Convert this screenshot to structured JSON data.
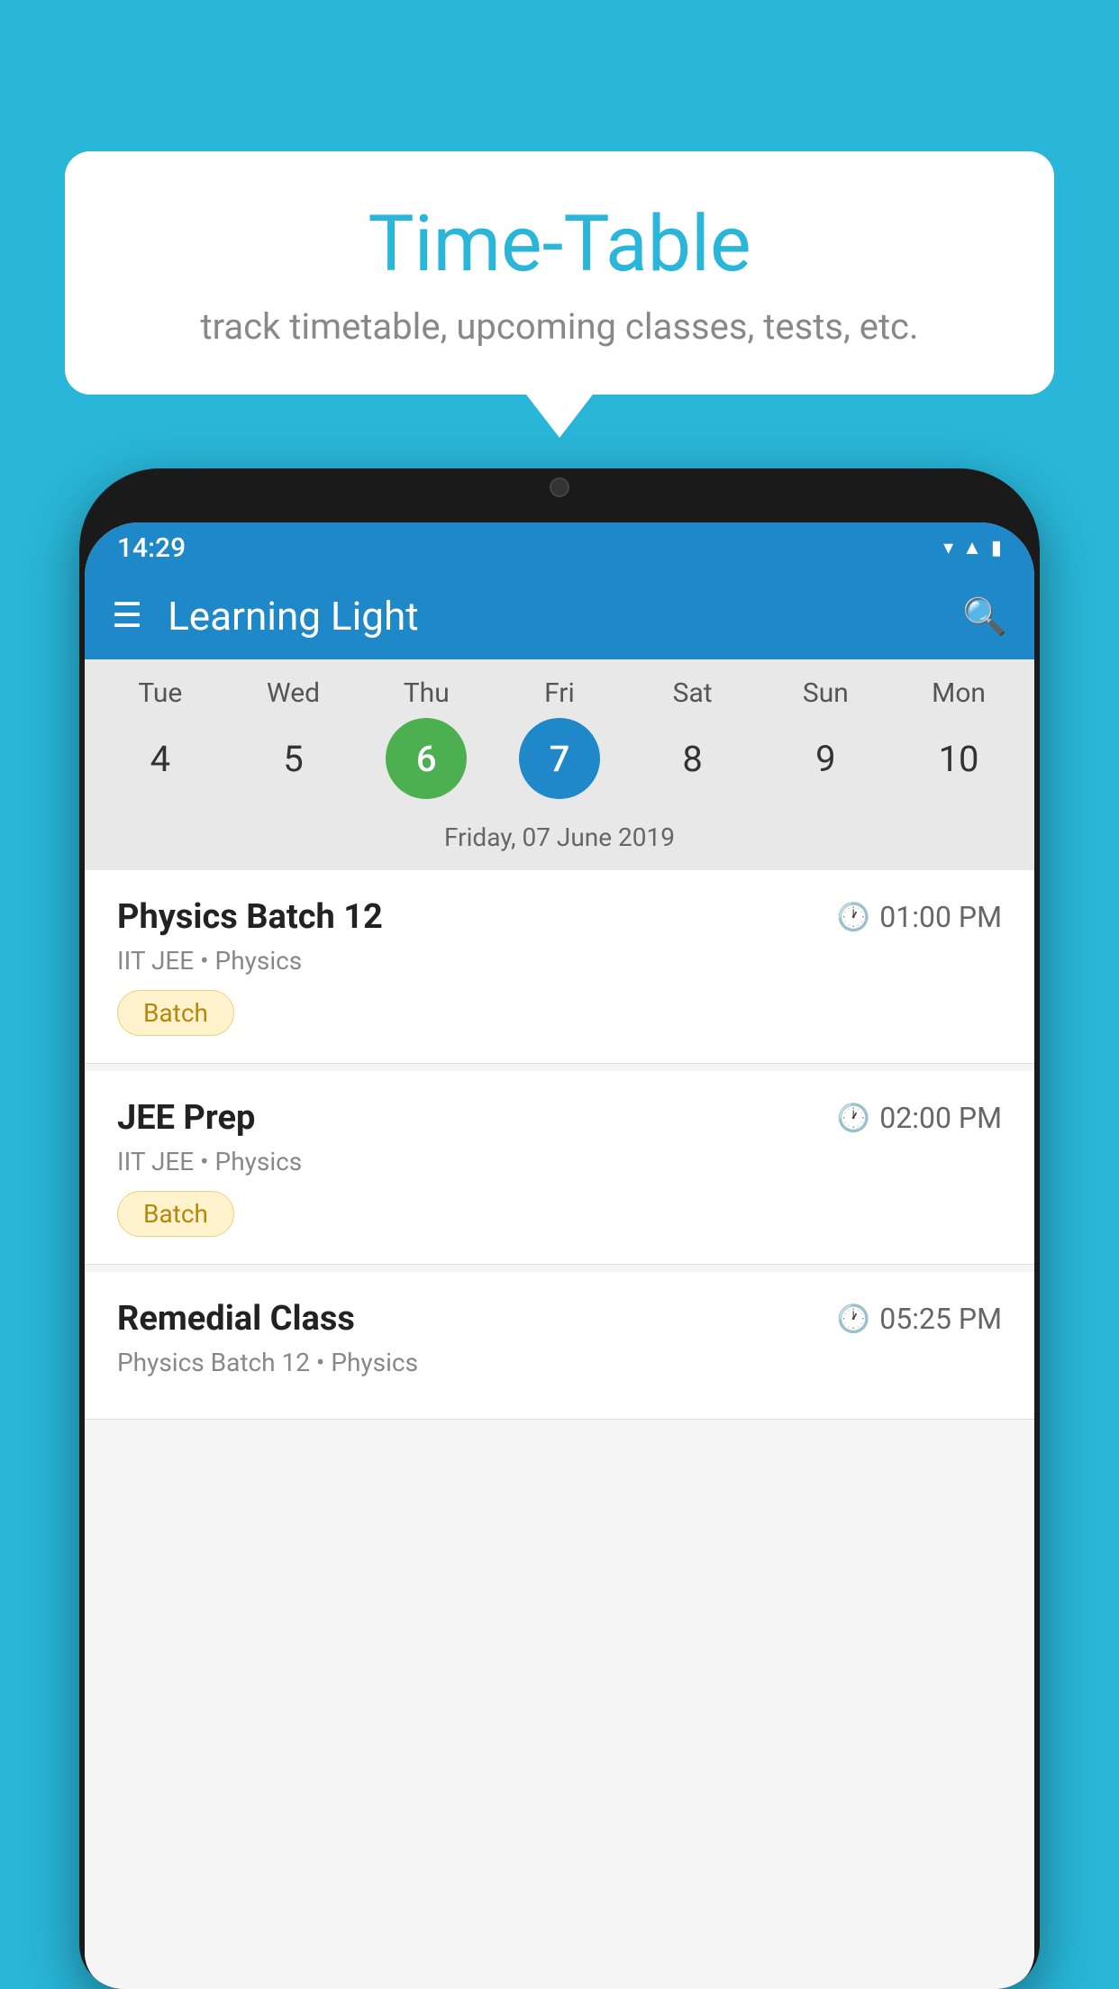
{
  "background": {
    "color": "#29b6d8"
  },
  "bubble": {
    "title": "Time-Table",
    "subtitle": "track timetable, upcoming classes, tests, etc."
  },
  "phone": {
    "status_bar": {
      "time": "14:29"
    },
    "app_bar": {
      "title": "Learning Light"
    },
    "calendar": {
      "days": [
        {
          "name": "Tue",
          "num": "4",
          "state": "normal"
        },
        {
          "name": "Wed",
          "num": "5",
          "state": "normal"
        },
        {
          "name": "Thu",
          "num": "6",
          "state": "today"
        },
        {
          "name": "Fri",
          "num": "7",
          "state": "selected"
        },
        {
          "name": "Sat",
          "num": "8",
          "state": "normal"
        },
        {
          "name": "Sun",
          "num": "9",
          "state": "normal"
        },
        {
          "name": "Mon",
          "num": "10",
          "state": "normal"
        }
      ],
      "current_date": "Friday, 07 June 2019"
    },
    "classes": [
      {
        "name": "Physics Batch 12",
        "time": "01:00 PM",
        "meta": "IIT JEE • Physics",
        "badge": "Batch"
      },
      {
        "name": "JEE Prep",
        "time": "02:00 PM",
        "meta": "IIT JEE • Physics",
        "badge": "Batch"
      },
      {
        "name": "Remedial Class",
        "time": "05:25 PM",
        "meta": "Physics Batch 12 • Physics",
        "badge": ""
      }
    ]
  }
}
